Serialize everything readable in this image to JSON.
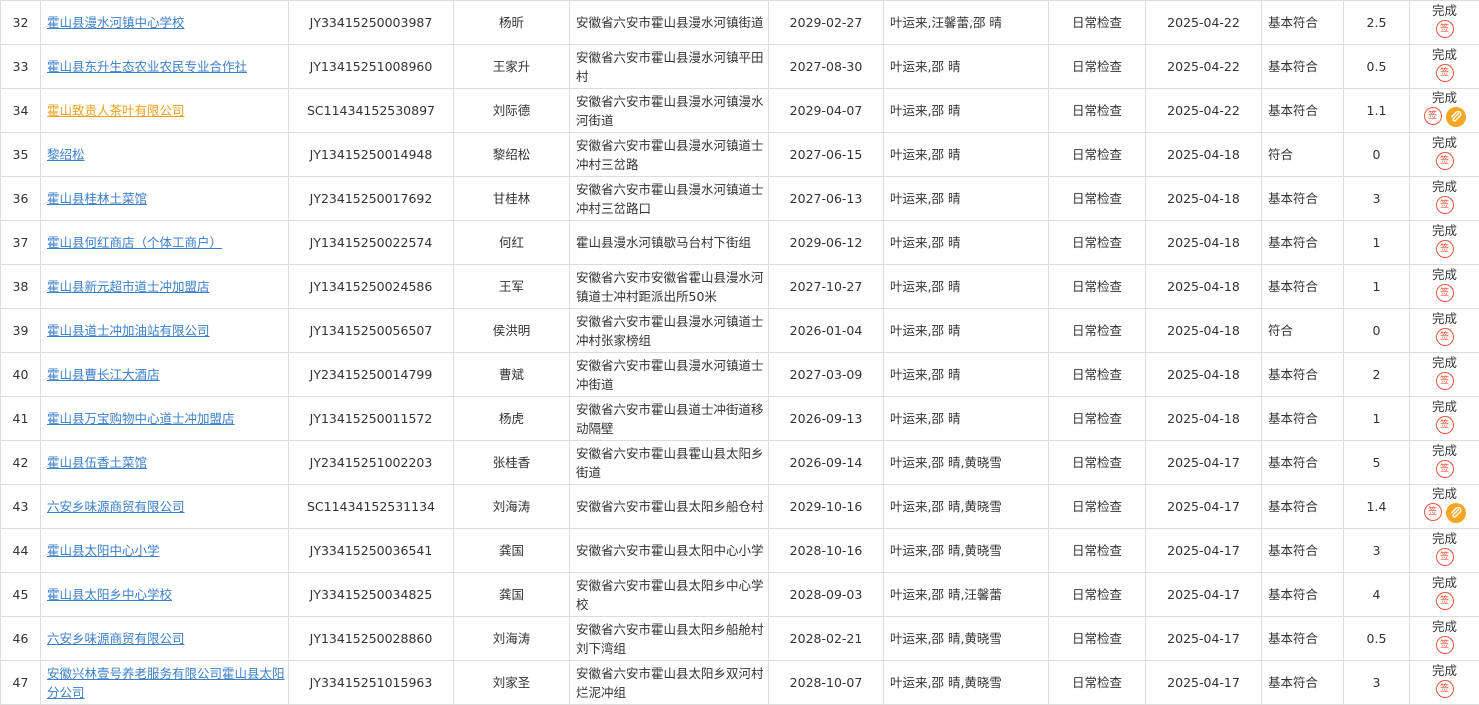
{
  "colors": {
    "link": "#3b7fc9",
    "link_highlight": "#f0a020",
    "sign": "#e9583f",
    "attach": "#f5a623",
    "border": "#dddddd"
  },
  "icons": {
    "sign": "sign-seal-icon",
    "attach": "paperclip-icon"
  },
  "sign_glyph": "签",
  "rows": [
    {
      "no": "32",
      "company": "霍山县漫水河镇中心学校",
      "license": "JY33415250003987",
      "person": "杨昕",
      "address": "安徽省六安市霍山县漫水河镇街道",
      "expiry": "2029-02-27",
      "inspectors": "叶运来,汪馨蕾,邵 晴",
      "type": "日常检查",
      "date": "2025-04-22",
      "result": "基本符合",
      "score": "2.5",
      "status": "完成",
      "attachment": false,
      "highlight": false
    },
    {
      "no": "33",
      "company": "霍山县东升生态农业农民专业合作社",
      "license": "JY13415251008960",
      "person": "王家升",
      "address": "安徽省六安市霍山县漫水河镇平田村",
      "expiry": "2027-08-30",
      "inspectors": "叶运来,邵 晴",
      "type": "日常检查",
      "date": "2025-04-22",
      "result": "基本符合",
      "score": "0.5",
      "status": "完成",
      "attachment": false,
      "highlight": false
    },
    {
      "no": "34",
      "company": "霍山致贵人茶叶有限公司",
      "license": "SC11434152530897",
      "person": "刘际德",
      "address": "安徽省六安市霍山县漫水河镇漫水河街道",
      "expiry": "2029-04-07",
      "inspectors": "叶运来,邵 晴",
      "type": "日常检查",
      "date": "2025-04-22",
      "result": "基本符合",
      "score": "1.1",
      "status": "完成",
      "attachment": true,
      "highlight": true
    },
    {
      "no": "35",
      "company": "黎绍松",
      "license": "JY13415250014948",
      "person": "黎绍松",
      "address": "安徽省六安市霍山县漫水河镇道士冲村三岔路",
      "expiry": "2027-06-15",
      "inspectors": "叶运来,邵 晴",
      "type": "日常检查",
      "date": "2025-04-18",
      "result": "符合",
      "score": "0",
      "status": "完成",
      "attachment": false,
      "highlight": false
    },
    {
      "no": "36",
      "company": "霍山县桂林土菜馆",
      "license": "JY23415250017692",
      "person": "甘桂林",
      "address": "安徽省六安市霍山县漫水河镇道士冲村三岔路口",
      "expiry": "2027-06-13",
      "inspectors": "叶运来,邵 晴",
      "type": "日常检查",
      "date": "2025-04-18",
      "result": "基本符合",
      "score": "3",
      "status": "完成",
      "attachment": false,
      "highlight": false
    },
    {
      "no": "37",
      "company": "霍山县何红商店（个体工商户）",
      "license": "JY13415250022574",
      "person": "何红",
      "address": "霍山县漫水河镇歇马台村下街组",
      "expiry": "2029-06-12",
      "inspectors": "叶运来,邵 晴",
      "type": "日常检查",
      "date": "2025-04-18",
      "result": "基本符合",
      "score": "1",
      "status": "完成",
      "attachment": false,
      "highlight": false
    },
    {
      "no": "38",
      "company": "霍山县新元超市道士冲加盟店",
      "license": "JY13415250024586",
      "person": "王军",
      "address": "安徽省六安市安徽省霍山县漫水河镇道士冲村距派出所50米",
      "expiry": "2027-10-27",
      "inspectors": "叶运来,邵 晴",
      "type": "日常检查",
      "date": "2025-04-18",
      "result": "基本符合",
      "score": "1",
      "status": "完成",
      "attachment": false,
      "highlight": false
    },
    {
      "no": "39",
      "company": "霍山县道士冲加油站有限公司",
      "license": "JY13415250056507",
      "person": "侯洪明",
      "address": "安徽省六安市霍山县漫水河镇道士冲村张家榜组",
      "expiry": "2026-01-04",
      "inspectors": "叶运来,邵 晴",
      "type": "日常检查",
      "date": "2025-04-18",
      "result": "符合",
      "score": "0",
      "status": "完成",
      "attachment": false,
      "highlight": false
    },
    {
      "no": "40",
      "company": "霍山县曹长江大酒店",
      "license": "JY23415250014799",
      "person": "曹斌",
      "address": "安徽省六安市霍山县漫水河镇道士冲街道",
      "expiry": "2027-03-09",
      "inspectors": "叶运来,邵 晴",
      "type": "日常检查",
      "date": "2025-04-18",
      "result": "基本符合",
      "score": "2",
      "status": "完成",
      "attachment": false,
      "highlight": false
    },
    {
      "no": "41",
      "company": "霍山县万宝购物中心道士冲加盟店",
      "license": "JY13415250011572",
      "person": "杨虎",
      "address": "安徽省六安市霍山县道士冲街道移动隔壁",
      "expiry": "2026-09-13",
      "inspectors": "叶运来,邵 晴",
      "type": "日常检查",
      "date": "2025-04-18",
      "result": "基本符合",
      "score": "1",
      "status": "完成",
      "attachment": false,
      "highlight": false
    },
    {
      "no": "42",
      "company": "霍山县伍香土菜馆",
      "license": "JY23415251002203",
      "person": "张桂香",
      "address": "安徽省六安市霍山县霍山县太阳乡街道",
      "expiry": "2026-09-14",
      "inspectors": "叶运来,邵 晴,黄晓雪",
      "type": "日常检查",
      "date": "2025-04-17",
      "result": "基本符合",
      "score": "5",
      "status": "完成",
      "attachment": false,
      "highlight": false
    },
    {
      "no": "43",
      "company": "六安乡味源商贸有限公司",
      "license": "SC11434152531134",
      "person": "刘海涛",
      "address": "安徽省六安市霍山县太阳乡船仓村",
      "expiry": "2029-10-16",
      "inspectors": "叶运来,邵 晴,黄晓雪",
      "type": "日常检查",
      "date": "2025-04-17",
      "result": "基本符合",
      "score": "1.4",
      "status": "完成",
      "attachment": true,
      "highlight": false
    },
    {
      "no": "44",
      "company": "霍山县太阳中心小学",
      "license": "JY33415250036541",
      "person": "龚国",
      "address": "安徽省六安市霍山县太阳中心小学",
      "expiry": "2028-10-16",
      "inspectors": "叶运来,邵 晴,黄晓雪",
      "type": "日常检查",
      "date": "2025-04-17",
      "result": "基本符合",
      "score": "3",
      "status": "完成",
      "attachment": false,
      "highlight": false
    },
    {
      "no": "45",
      "company": "霍山县太阳乡中心学校",
      "license": "JY33415250034825",
      "person": "龚国",
      "address": "安徽省六安市霍山县太阳乡中心学校",
      "expiry": "2028-09-03",
      "inspectors": "叶运来,邵 晴,汪馨蕾",
      "type": "日常检查",
      "date": "2025-04-17",
      "result": "基本符合",
      "score": "4",
      "status": "完成",
      "attachment": false,
      "highlight": false
    },
    {
      "no": "46",
      "company": "六安乡味源商贸有限公司",
      "license": "JY13415250028860",
      "person": "刘海涛",
      "address": "安徽省六安市霍山县太阳乡船舱村刘下湾组",
      "expiry": "2028-02-21",
      "inspectors": "叶运来,邵 晴,黄晓雪",
      "type": "日常检查",
      "date": "2025-04-17",
      "result": "基本符合",
      "score": "0.5",
      "status": "完成",
      "attachment": false,
      "highlight": false
    },
    {
      "no": "47",
      "company": "安徽兴林壹号养老服务有限公司霍山县太阳分公司",
      "license": "JY33415251015963",
      "person": "刘家圣",
      "address": "安徽省六安市霍山县太阳乡双河村烂泥冲组",
      "expiry": "2028-10-07",
      "inspectors": "叶运来,邵 晴,黄晓雪",
      "type": "日常检查",
      "date": "2025-04-17",
      "result": "基本符合",
      "score": "3",
      "status": "完成",
      "attachment": false,
      "highlight": false
    }
  ]
}
